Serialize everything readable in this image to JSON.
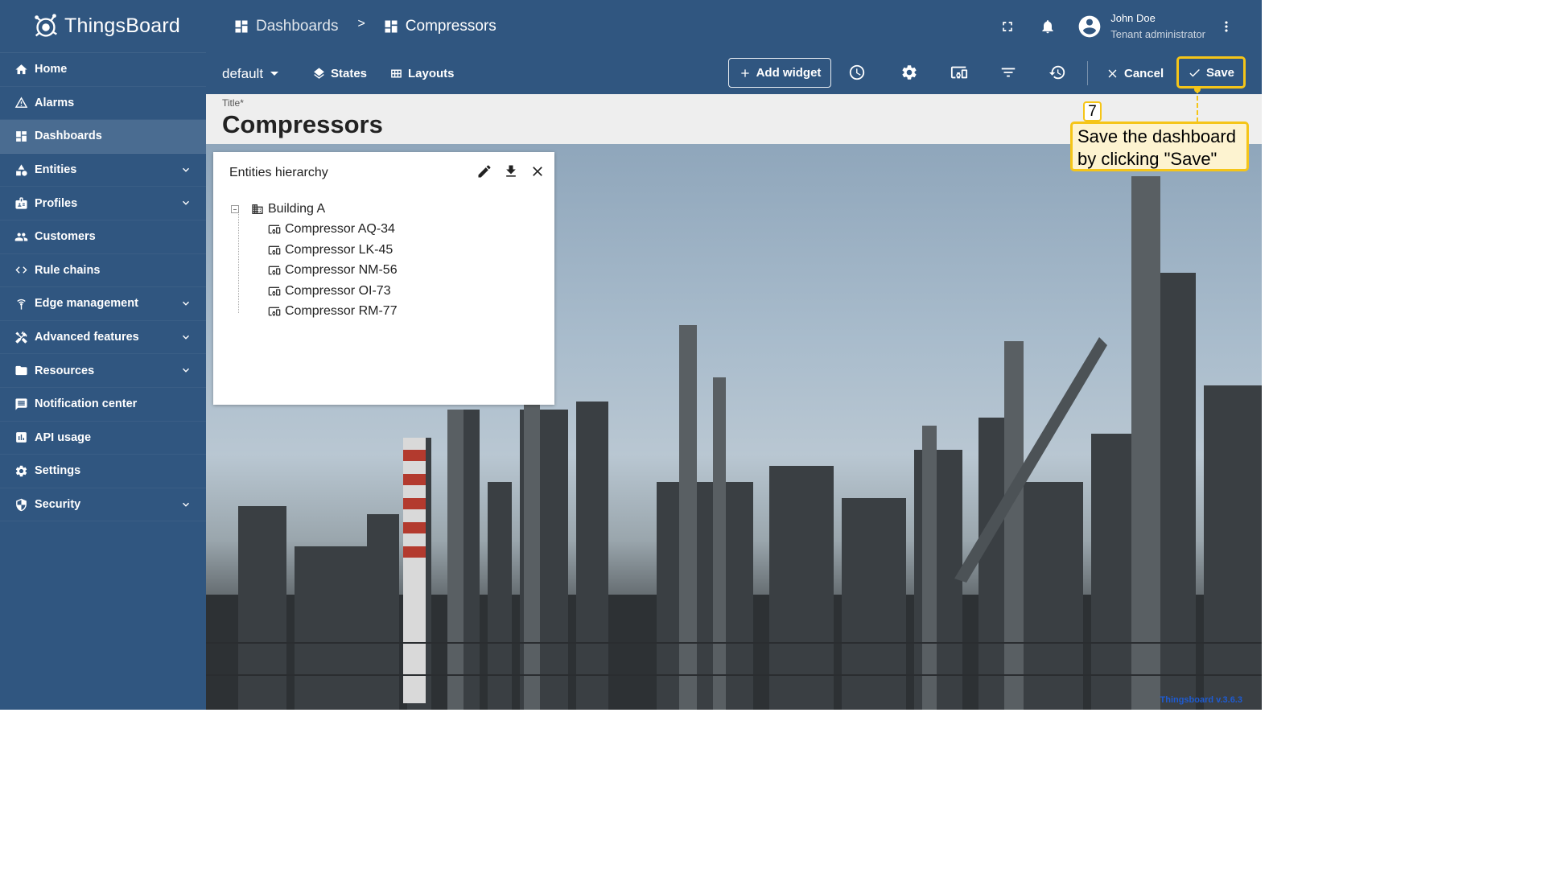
{
  "app": {
    "name": "ThingsBoard"
  },
  "sidebar": {
    "items": [
      {
        "label": "Home",
        "icon": "home-icon"
      },
      {
        "label": "Alarms",
        "icon": "warning-icon"
      },
      {
        "label": "Dashboards",
        "icon": "dashboard-icon",
        "active": true
      },
      {
        "label": "Entities",
        "icon": "entities-icon",
        "expandable": true
      },
      {
        "label": "Profiles",
        "icon": "badge-icon",
        "expandable": true
      },
      {
        "label": "Customers",
        "icon": "people-icon"
      },
      {
        "label": "Rule chains",
        "icon": "code-arrows-icon"
      },
      {
        "label": "Edge management",
        "icon": "wifi-tower-icon",
        "expandable": true
      },
      {
        "label": "Advanced features",
        "icon": "tools-icon",
        "expandable": true
      },
      {
        "label": "Resources",
        "icon": "folder-icon",
        "expandable": true
      },
      {
        "label": "Notification center",
        "icon": "message-icon"
      },
      {
        "label": "API usage",
        "icon": "bar-chart-icon"
      },
      {
        "label": "Settings",
        "icon": "gear-icon"
      },
      {
        "label": "Security",
        "icon": "shield-icon",
        "expandable": true
      }
    ]
  },
  "header": {
    "breadcrumb": [
      "Dashboards",
      ">",
      "Compressors"
    ],
    "user": {
      "name": "John Doe",
      "role": "Tenant administrator"
    }
  },
  "toolbar": {
    "state": "default",
    "states_label": "States",
    "layouts_label": "Layouts",
    "add_widget_label": "Add widget",
    "cancel_label": "Cancel",
    "save_label": "Save"
  },
  "dashboard": {
    "title_label": "Title*",
    "title_value": "Compressors",
    "version": "Thingsboard v.3.6.3"
  },
  "widget": {
    "title": "Entities hierarchy",
    "root": "Building A",
    "children": [
      "Compressor AQ-34",
      "Compressor LK-45",
      "Compressor NM-56",
      "Compressor OI-73",
      "Compressor RM-77"
    ]
  },
  "tutorial": {
    "step": "7",
    "text_line1": "Save the dashboard",
    "text_line2": "by clicking \"Save\"",
    "accent": "#f5c518"
  },
  "colors": {
    "primary": "#305680",
    "active_item": "#4a6c91",
    "title_bg": "#eeeeee"
  }
}
